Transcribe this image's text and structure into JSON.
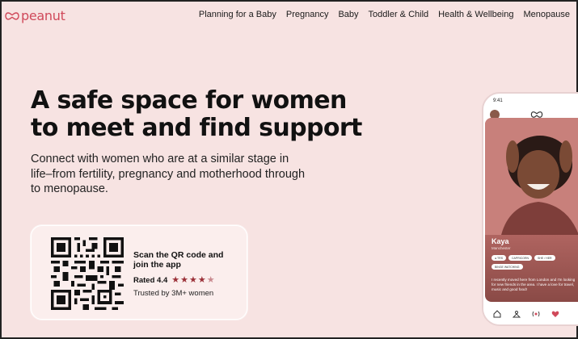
{
  "brand": {
    "name": "peanut",
    "color": "#d0495a"
  },
  "nav": {
    "items": [
      {
        "label": "Planning for a Baby"
      },
      {
        "label": "Pregnancy"
      },
      {
        "label": "Baby"
      },
      {
        "label": "Toddler & Child"
      },
      {
        "label": "Health & Wellbeing"
      },
      {
        "label": "Menopause"
      }
    ]
  },
  "hero": {
    "headline": "A safe space for women to meet and find support",
    "subtext": "Connect with women who are at a similar stage in life–from fertility, pregnancy and motherhood through to menopause."
  },
  "qr_card": {
    "title": "Scan the QR code and join the app",
    "rating_label": "Rated 4.4",
    "rating_value": 4.4,
    "rating_max": 5,
    "trusted": "Trusted by 3M+ women",
    "star_color": "#9b3038"
  },
  "phone": {
    "time": "9:41",
    "profile": {
      "name": "Kaya",
      "location": "Manchester",
      "chips_row1": [
        "● TRS",
        "CAPRICORN",
        "SHE / HER"
      ],
      "chips_row2": [
        "BINGE WATCHING"
      ],
      "bio": "I recently moved here from London and I'm looking for new friends in the area. I have a love for travel, music and good food!"
    },
    "tabs": [
      "home-icon",
      "community-icon",
      "live-icon",
      "heart-icon"
    ]
  }
}
